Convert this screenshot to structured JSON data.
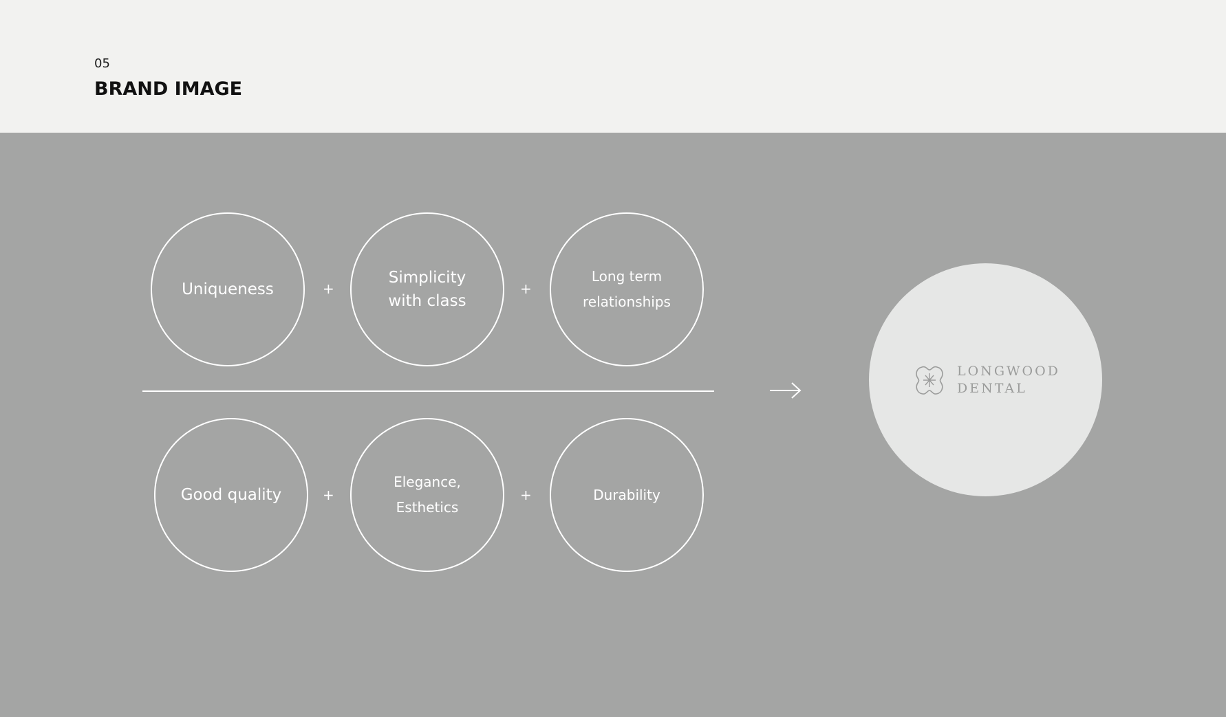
{
  "header": {
    "section_number": "05",
    "section_title": "BRAND IMAGE"
  },
  "diagram": {
    "top_row": [
      "Uniqueness",
      "Simplicity\nwith class",
      "Long term\nrelationships"
    ],
    "bottom_row": [
      "Good quality",
      "Elegance,\nEsthetics",
      "Durability"
    ],
    "operator": "+",
    "result_icon": "arrow-right-icon"
  },
  "logo": {
    "line1": "LONGWOOD",
    "line2": "DENTAL",
    "mark_icon": "tooth-asterisk-icon"
  },
  "colors": {
    "header_bg": "#f2f2f0",
    "panel_bg": "#a4a5a4",
    "logo_circle": "#e6e7e6",
    "logo_text": "#9b9c9b",
    "line": "#ffffff"
  }
}
